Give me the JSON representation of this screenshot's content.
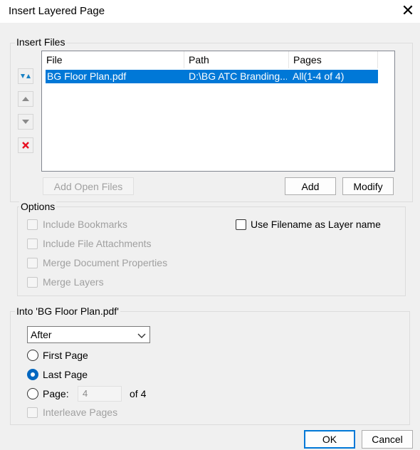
{
  "window": {
    "title": "Insert Layered Page",
    "close_glyph": "✕"
  },
  "insert_files": {
    "label": "Insert Files",
    "columns": [
      "File",
      "Path",
      "Pages"
    ],
    "rows": [
      {
        "file": "BG Floor Plan.pdf",
        "path": "D:\\BG ATC Branding...",
        "pages": "All(1-4 of 4)"
      }
    ],
    "side_buttons": [
      "move-top-icon",
      "move-up-icon",
      "move-down-icon",
      "delete-icon"
    ],
    "add_open_files": "Add Open Files",
    "add": "Add",
    "modify": "Modify"
  },
  "options": {
    "label": "Options",
    "include_bookmarks": "Include Bookmarks",
    "include_file_attachments": "Include File Attachments",
    "merge_document_properties": "Merge Document Properties",
    "merge_layers": "Merge Layers",
    "use_filename_as_layer": "Use Filename as Layer name"
  },
  "into": {
    "label": "Into 'BG Floor Plan.pdf'",
    "position_select": "After",
    "first_page": "First Page",
    "last_page": "Last Page",
    "page_label": "Page:",
    "page_value": "4",
    "page_of": "of 4",
    "interleave": "Interleave Pages",
    "selected": "last_page"
  },
  "footer": {
    "ok": "OK",
    "cancel": "Cancel"
  },
  "colors": {
    "selection": "#0078d7",
    "radio_accent": "#0067c0",
    "delete_red": "#e81123",
    "arrow_blue": "#1a82c4"
  }
}
